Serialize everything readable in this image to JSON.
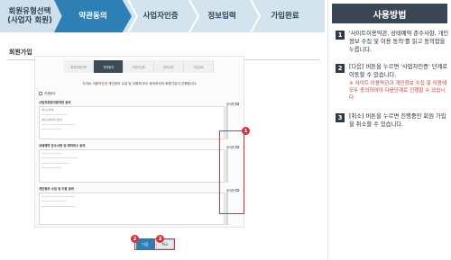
{
  "steps": [
    {
      "label": "회원유형선택\n(사업자 회원)",
      "active": false
    },
    {
      "label": "약관동의",
      "active": true
    },
    {
      "label": "사업자인증",
      "active": false
    },
    {
      "label": "정보입력",
      "active": false
    },
    {
      "label": "가입완료",
      "active": false
    }
  ],
  "panel": {
    "title": "사용방법",
    "tips": [
      {
        "num": "1",
        "text": "'사이트이용약관, 상태예약 준수사항, 개인정보 수집 및 이용 동의'를 읽고 동의함을 누릅니다."
      },
      {
        "num": "2",
        "text": "[다음] 버튼을 누르면 '사업자인증' 단계로 이동할 수 있습니다.",
        "warn": "※ 사이트 이용약관과 개인정보 수집 및 이용에 모두 동의하여야 다음단계로 진행할 수 있습니다."
      },
      {
        "num": "3",
        "text": "[취소] 버튼을 누르면 진행중인 회원 가입을 취소할 수 있습니다."
      }
    ]
  },
  "main": {
    "page_title": "회원가입",
    "mini_steps": [
      "회원유형선택",
      "약관동의",
      "사업자인증",
      "정보입력",
      "가입완료"
    ],
    "notice": "사이트 이용약관과 개인정보 수집 및 이용에 모두 동의하셔야 회원가입이 진행됩니다.",
    "agree_all": "전체동의",
    "sections": [
      {
        "head": "사업자회원이용약관 동의",
        "agree": "동의함"
      },
      {
        "head": "상태예약 준수사항 및 예약취소 동의",
        "agree": "동의함"
      },
      {
        "head": "개인정보 수집 및 이용 동의",
        "agree": "동의함"
      }
    ],
    "next_button": "다음",
    "cancel_button": "취소",
    "badges": [
      "1",
      "2",
      "3"
    ]
  },
  "colors": {
    "accent": "#2e7fb6",
    "highlight": "#d8323a",
    "panel_dark": "#3a4654"
  }
}
